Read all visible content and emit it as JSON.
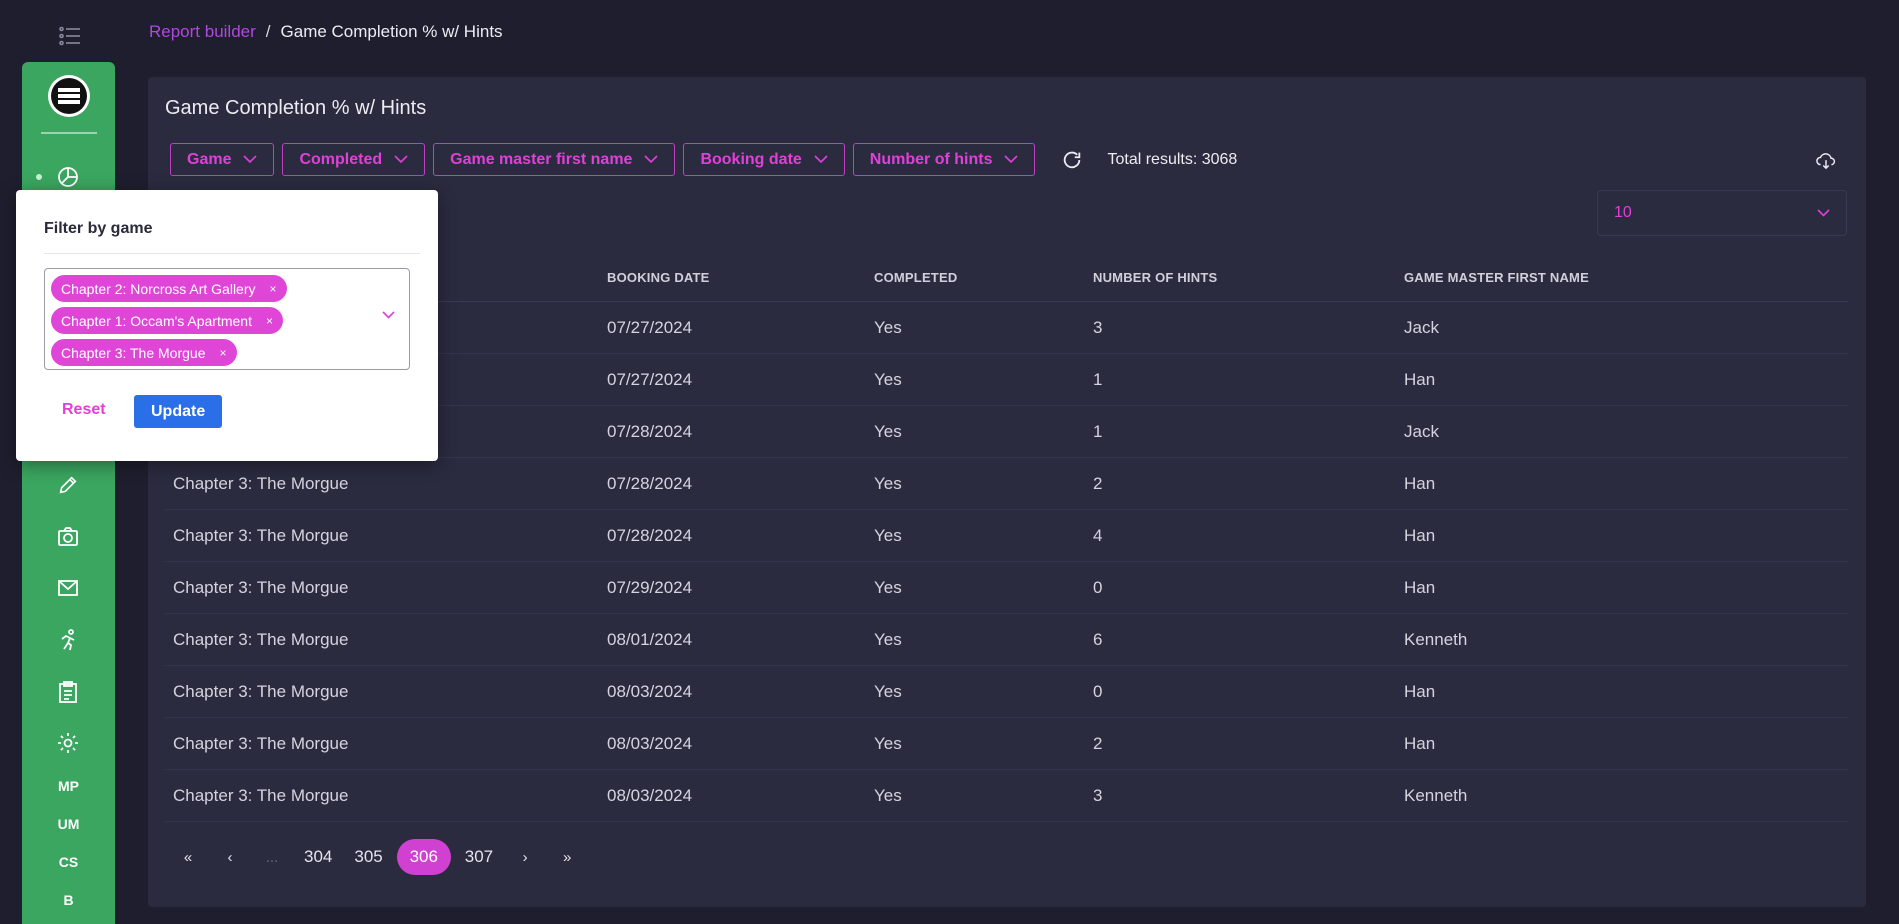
{
  "breadcrumb": {
    "link": "Report builder",
    "separator": "/",
    "current": "Game Completion % w/ Hints"
  },
  "sidebar": {
    "text_items": [
      "MP",
      "UM",
      "CS",
      "B"
    ],
    "accent_color": "#3aa65f"
  },
  "report": {
    "title": "Game Completion % w/ Hints",
    "filters": [
      "Game",
      "Completed",
      "Game master first name",
      "Booking date",
      "Number of hints"
    ],
    "total_results": "Total results: 3068",
    "page_size": "10"
  },
  "table": {
    "headers": [
      "",
      "BOOKING DATE",
      "COMPLETED",
      "NUMBER OF HINTS",
      "GAME MASTER FIRST NAME"
    ],
    "rows": [
      [
        "",
        "07/27/2024",
        "Yes",
        "3",
        "Jack"
      ],
      [
        "",
        "07/27/2024",
        "Yes",
        "1",
        "Han"
      ],
      [
        "",
        "07/28/2024",
        "Yes",
        "1",
        "Jack"
      ],
      [
        "Chapter 3: The Morgue",
        "07/28/2024",
        "Yes",
        "2",
        "Han"
      ],
      [
        "Chapter 3: The Morgue",
        "07/28/2024",
        "Yes",
        "4",
        "Han"
      ],
      [
        "Chapter 3: The Morgue",
        "07/29/2024",
        "Yes",
        "0",
        "Han"
      ],
      [
        "Chapter 3: The Morgue",
        "08/01/2024",
        "Yes",
        "6",
        "Kenneth"
      ],
      [
        "Chapter 3: The Morgue",
        "08/03/2024",
        "Yes",
        "0",
        "Han"
      ],
      [
        "Chapter 3: The Morgue",
        "08/03/2024",
        "Yes",
        "2",
        "Han"
      ],
      [
        "Chapter 3: The Morgue",
        "08/03/2024",
        "Yes",
        "3",
        "Kenneth"
      ]
    ]
  },
  "pagination": {
    "first": "«",
    "prev": "‹",
    "ellipsis": "...",
    "pages": [
      "304",
      "305",
      "306",
      "307"
    ],
    "active": "306",
    "next": "›",
    "last": "»"
  },
  "filter_popup": {
    "title": "Filter by game",
    "selected": [
      "Chapter 2: Norcross Art Gallery",
      "Chapter 1: Occam's Apartment",
      "Chapter 3: The Morgue"
    ],
    "remove_glyph": "×",
    "reset_label": "Reset",
    "update_label": "Update"
  },
  "colors": {
    "background": "#1f1e2e",
    "card": "#2b2b40",
    "accent_magenta": "#e040d8",
    "button_blue": "#2a6ee8"
  }
}
